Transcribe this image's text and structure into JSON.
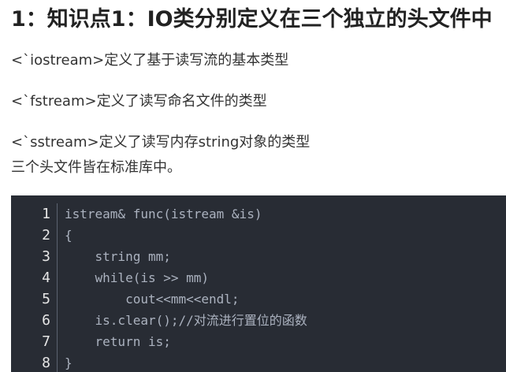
{
  "heading": "1：知识点1：IO类分别定义在三个独立的头文件中",
  "paragraphs": [
    "<`iostream>定义了基于读写流的基本类型",
    "<`fstream>定义了读写命名文件的类型",
    "<`sstream>定义了读写内存string对象的类型",
    "三个头文件皆在标准库中。"
  ],
  "code": {
    "line_numbers": [
      "1",
      "2",
      "3",
      "4",
      "5",
      "6",
      "7",
      "8"
    ],
    "lines": [
      "istream& func(istream &is)",
      "{",
      "    string mm;",
      "    while(is >> mm)",
      "        cout<<mm<<endl;",
      "    is.clear();//对流进行置位的函数",
      "    return is;",
      "}"
    ]
  },
  "colors": {
    "code_background": "#282c34",
    "code_text": "#abb2bf",
    "line_number_text": "#e6e6e6"
  }
}
